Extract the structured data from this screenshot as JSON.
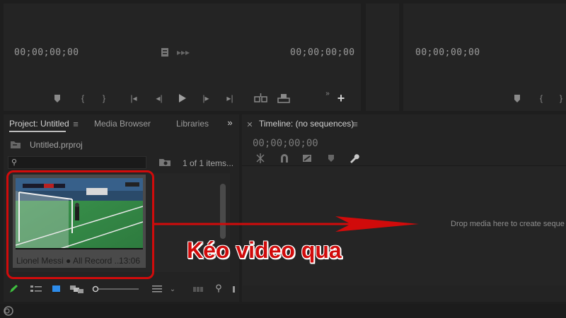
{
  "source_monitor": {
    "timecode_in": "00;00;00;00",
    "timecode_out": "00;00;00;00"
  },
  "program_monitor": {
    "timecode_in": "00;00;00;00"
  },
  "project_panel": {
    "tab_label": "Project: Untitled",
    "tab_media_browser": "Media Browser",
    "tab_libraries": "Libraries",
    "file_name": "Untitled.prproj",
    "items_count": "1 of 1 items...",
    "clip": {
      "name": "Lionel  Messi ● All Record ...",
      "duration": "13:06"
    }
  },
  "timeline_panel": {
    "title": "Timeline: (no sequences)",
    "timecode": "00;00;00;00",
    "drop_hint": "Drop media here to create seque"
  },
  "annotation": {
    "text": "Kéo video qua",
    "color": "#d10b0b"
  },
  "colors": {
    "accent_blue": "#2d8ceb",
    "pencil_green": "#3fbf3f"
  }
}
